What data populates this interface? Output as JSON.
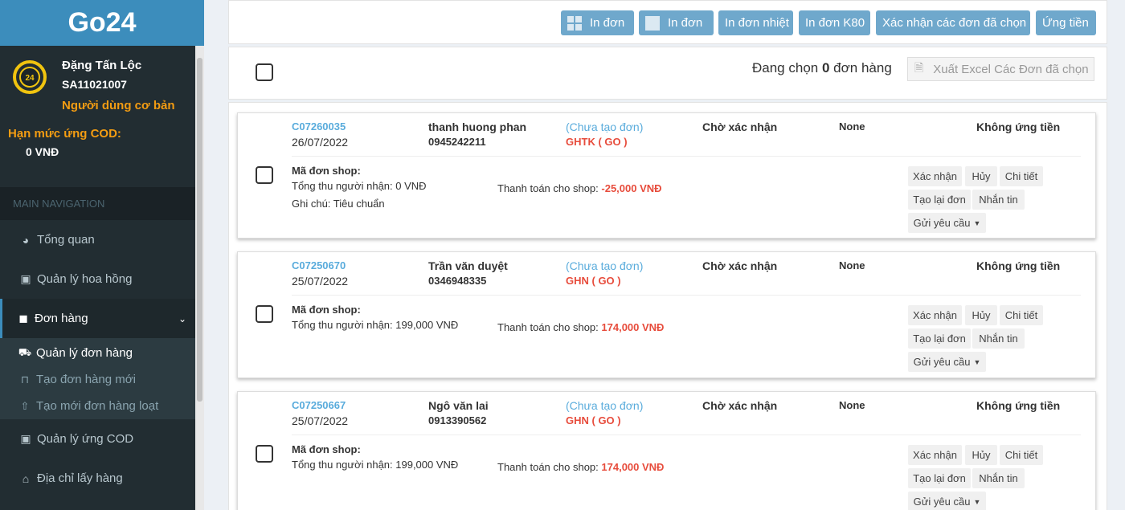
{
  "app": {
    "logo": "Go24"
  },
  "user": {
    "name": "Đặng Tấn Lộc",
    "code": "SA11021007",
    "role": "Người dùng cơ bản"
  },
  "cod_limit": {
    "label": "Hạn mức ứng COD:",
    "value": "0 VNĐ"
  },
  "nav": {
    "header": "MAIN NAVIGATION",
    "items": [
      {
        "label": "Tổng quan",
        "icon": "tachometer-icon"
      },
      {
        "label": "Quản lý hoa hồng",
        "icon": "money-icon"
      },
      {
        "label": "Đơn hàng",
        "icon": "shopping-bag-icon"
      },
      {
        "label": "Quản lý ứng COD",
        "icon": "money-icon"
      },
      {
        "label": "Địa chỉ lấy hàng",
        "icon": "bank-icon"
      }
    ],
    "subitems": [
      {
        "label": "Quản lý đơn hàng",
        "icon": "truck-icon"
      },
      {
        "label": "Tạo đơn hàng mới",
        "icon": "cart-icon"
      },
      {
        "label": "Tạo mới đơn hàng loạt",
        "icon": "upload-icon"
      }
    ]
  },
  "toolbar": {
    "print_grid": "In đơn",
    "print_single": "In đơn",
    "print_thermal": "In đơn nhiệt",
    "print_k80": "In đơn K80",
    "confirm_selected": "Xác nhận các đơn đã chọn",
    "advance": "Ứng tiền"
  },
  "selection": {
    "prefix": "Đang chọn",
    "count": "0",
    "suffix": "đơn hàng",
    "export": "Xuất Excel Các Đơn đã chọn"
  },
  "card_labels": {
    "shop_code": "Mã đơn shop:",
    "pay_to_shop": "Thanh toán cho shop:",
    "confirm": "Xác nhận",
    "cancel": "Hủy",
    "detail": "Chi tiết",
    "recreate": "Tạo lại đơn",
    "message": "Nhắn tin",
    "send_request": "Gửi yêu cầu"
  },
  "orders": [
    {
      "code": "C07260035",
      "date": "26/07/2022",
      "customer": "thanh huong phan",
      "phone": "0945242211",
      "order_status": "(Chưa tạo đơn)",
      "carrier": "GHTK ( GO )",
      "confirm_status": "Chờ xác nhận",
      "extra_status": "None",
      "advance_status": "Không ứng tiền",
      "total": "Tổng thu người nhận: 0 VNĐ",
      "note": "Ghi chú: Tiêu chuẩn",
      "pay_amount": "-25,000 VNĐ"
    },
    {
      "code": "C07250670",
      "date": "25/07/2022",
      "customer": "Trần văn duyệt",
      "phone": "0346948335",
      "order_status": "(Chưa tạo đơn)",
      "carrier": "GHN ( GO )",
      "confirm_status": "Chờ xác nhận",
      "extra_status": "None",
      "advance_status": "Không ứng tiền",
      "total": "Tổng thu người nhận: 199,000 VNĐ",
      "note": "",
      "pay_amount": "174,000 VNĐ"
    },
    {
      "code": "C07250667",
      "date": "25/07/2022",
      "customer": "Ngô văn lai",
      "phone": "0913390562",
      "order_status": "(Chưa tạo đơn)",
      "carrier": "GHN ( GO )",
      "confirm_status": "Chờ xác nhận",
      "extra_status": "None",
      "advance_status": "Không ứng tiền",
      "total": "Tổng thu người nhận: 199,000 VNĐ",
      "note": "",
      "pay_amount": "174,000 VNĐ"
    }
  ]
}
